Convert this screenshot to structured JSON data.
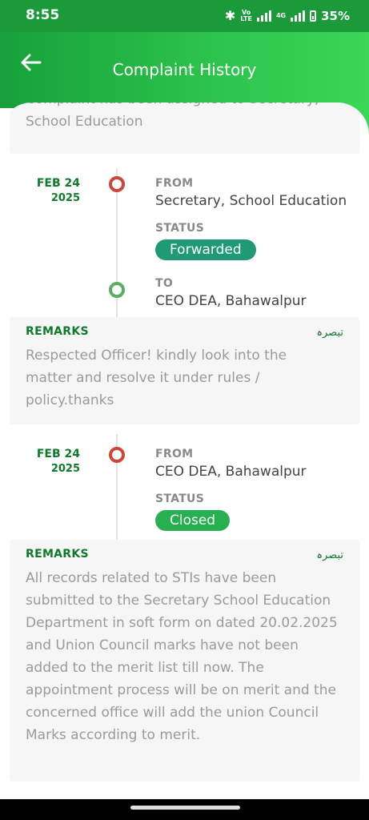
{
  "status_bar": {
    "time": "8:55",
    "battery": "35%",
    "network_1": "LTE",
    "network_2": "4G"
  },
  "app_bar": {
    "title": "Complaint History"
  },
  "top_remark": {
    "text": "Complaint has been assigned to Secretary, School Education"
  },
  "entries": [
    {
      "date": "FEB 24",
      "year": "2025",
      "from_label": "FROM",
      "from": "Secretary, School Education",
      "status_label": "STATUS",
      "status": "Forwarded",
      "status_color": "#1f9a74",
      "to_label": "TO",
      "to": "CEO DEA, Bahawalpur",
      "remarks_label": "REMARKS",
      "remarks_urdu": "تبصرہ",
      "remarks": "Respected Officer! kindly look into the matter and resolve it under rules / policy.thanks"
    },
    {
      "date": "FEB 24",
      "year": "2025",
      "from_label": "FROM",
      "from": "CEO DEA, Bahawalpur",
      "status_label": "STATUS",
      "status": "Closed",
      "status_color": "#27b04f",
      "remarks_label": "REMARKS",
      "remarks_urdu": "تبصرہ",
      "remarks": "All records related to STIs have been submitted to the Secretary School Education Department in soft form on dated 20.02.2025 and Union Council marks have not been added to the merit list till now. The appointment process will be on merit and the concerned office will add the union Council  Marks according to merit."
    }
  ]
}
